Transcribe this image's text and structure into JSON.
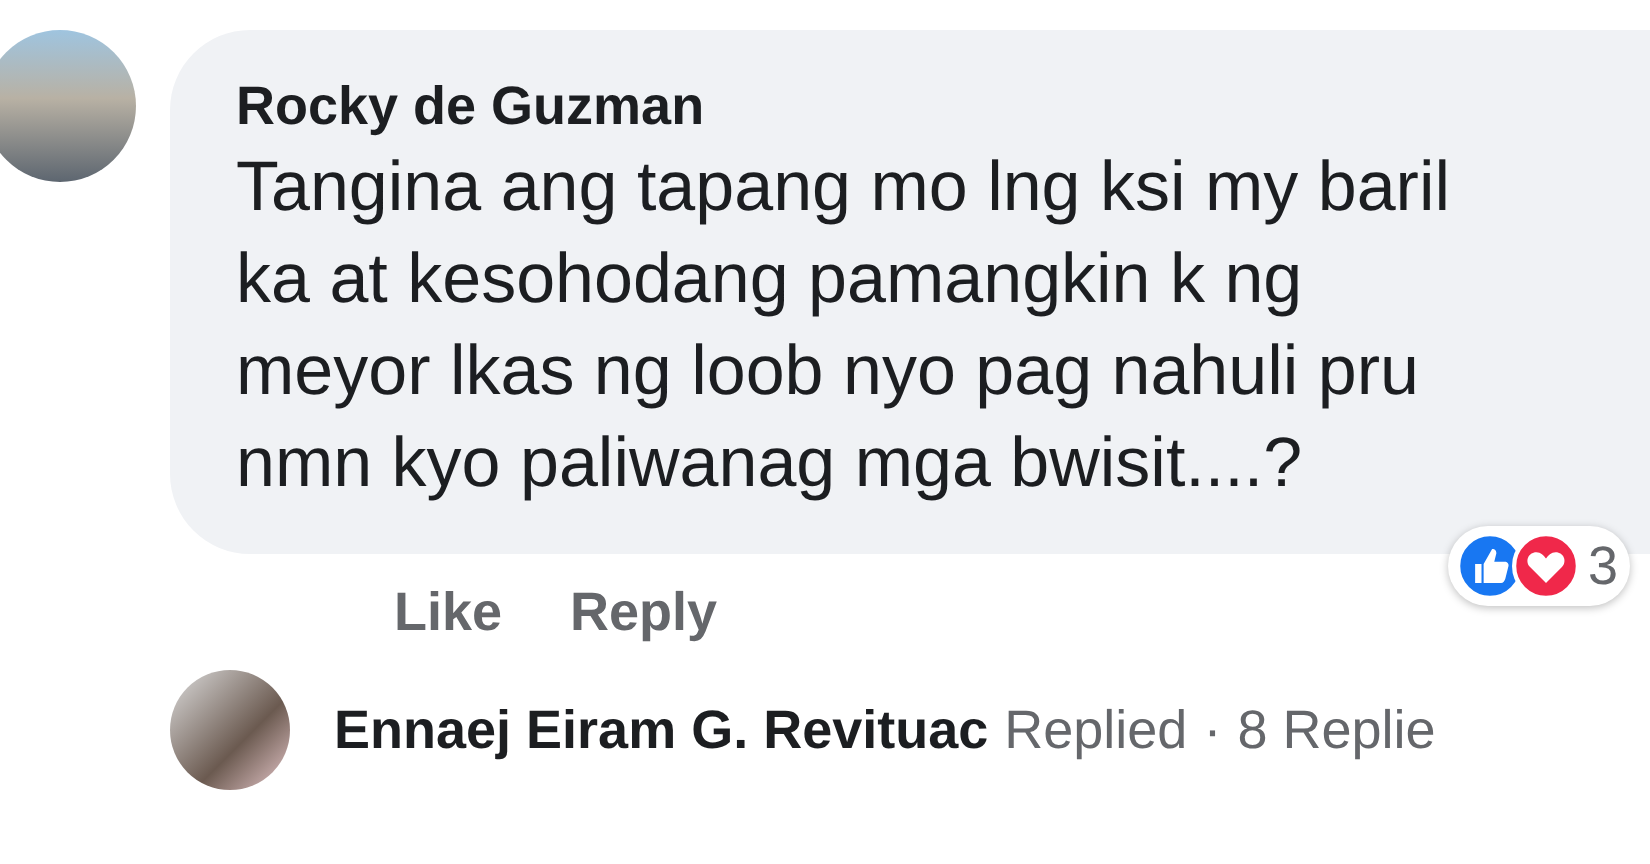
{
  "comment": {
    "author": "Rocky de Guzman",
    "lines": [
      "Tangina ang tapang mo lng ksi my baril",
      "ka at kesohodang pamangkin k ng",
      "meyor lkas ng loob nyo pag nahuli pru",
      "nmn kyo paliwanag mga bwisit....?"
    ],
    "reaction_count": "3",
    "actions": [
      "Like",
      "Reply"
    ]
  },
  "reply_summary": {
    "author": "Ennaej Eiram G. Revituac",
    "verb": "Replied",
    "separator": "·",
    "count": "8 Replie"
  }
}
